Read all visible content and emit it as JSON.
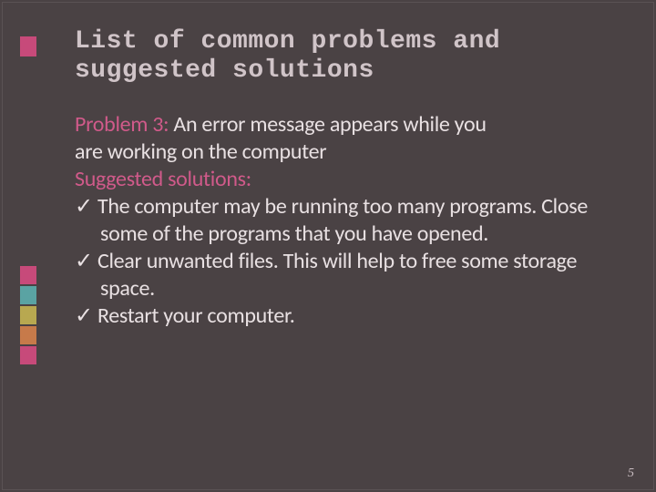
{
  "title": "List of common problems and suggested solutions",
  "problem": {
    "label": "Problem 3:",
    "text_line1": " An error message appears while you",
    "text_line2": " are working on the computer"
  },
  "suggested_label": "Suggested solutions:",
  "checkmark": "✓",
  "bullets": [
    "The computer may be running too many programs. Close some of the programs that you have opened.",
    "Clear unwanted files. This will help to free some storage space.",
    "Restart your computer."
  ],
  "page_number": "5"
}
